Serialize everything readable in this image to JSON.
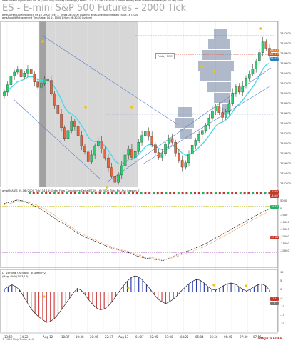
{
  "window": {
    "title": "ES - E-mini S&P 500 Futures - 2000 Tick",
    "info_lines": [
      "amaCurrentDayVWAP(ES 09-16 (2000 Tick) Nasdaq Exchange_Theme 1 0.5 1 2 3 Hi 08:30:00 Custom Hover) amaCurrentDayMedian(ES 09-16 (2000",
      "amaCurrentDayMedian(ES 09-16 (2000 Tick) ... Times 08:30:00 Custom) amaCurrentDayMedian(ES 09-16 (2000",
      "amaAutoFibRetracement Time/Label 14 14 1000 1 Hum 08:30:00 Custom)"
    ]
  },
  "price_pane": {
    "y_ticks": [
      "2852.00",
      "2850.00",
      "2848.00",
      "2846.00",
      "2844.00",
      "2842.00",
      "2840.00",
      "2838.00",
      "2836.00",
      "2834.00",
      "2832.00",
      "2830.00",
      "2828.00",
      "2826.00",
      "2824.00",
      "2822.00",
      "2820.00"
    ],
    "price_badges": [
      {
        "value": "2847.75",
        "color": "#e67e22"
      },
      {
        "value": "2847.50",
        "color": "#d35400"
      },
      {
        "value": "2845.75",
        "color": "#2980b9"
      }
    ],
    "prior_poc_label": "Friday POC"
  },
  "cumdelta_pane": {
    "label": "amaSMA(ES 09-16 (2000 Tick),14,14) Order Flow Cumulative Delta(ES 09-16 (2000 Tick),Bid Ask Session,0)",
    "y_ticks": [
      "5000",
      "0",
      "-5000",
      "-10000",
      "-15000",
      "-20000",
      "-25000",
      "-30000"
    ],
    "badges": [
      {
        "value": "-1542",
        "color": "#c0392b"
      },
      {
        "value": "-3442",
        "color": "#c0392b"
      },
      {
        "value": "29.53",
        "color": "#27ae60"
      },
      {
        "value": "-15 20",
        "color": "#c0392b"
      }
    ]
  },
  "oscillator_pane": {
    "label_lines": [
      "LT_Zeroing_Oscillator_3(Speed)V2",
      "(Mag) DIO*(14,3,14)"
    ],
    "y_ticks": [
      "10",
      "5",
      "0",
      "-5",
      "-10",
      "-15",
      "-20"
    ],
    "badges": [
      {
        "value": "1.1",
        "color": "#c0392b"
      },
      {
        "value": "0",
        "color": "#777777"
      }
    ]
  },
  "x_axis": {
    "ticks": [
      "13:59",
      "14:22",
      "Aug 12",
      "18:37",
      "19:38",
      "20:46",
      "22:57",
      "Aug 13",
      "01:07",
      "02:05",
      "03:00",
      "04:25",
      "05:04",
      "05:56",
      "06:45",
      "07:30",
      "07:56"
    ]
  },
  "footer": {
    "copyright": "© 2016 NinjaTrader, LLC",
    "logo_text": "NINJATRADER"
  },
  "colors": {
    "up_candle": "#2ecc71",
    "down_candle": "#e8643a",
    "session_shade": "#b7b7b7",
    "weekend_shade": "#8a8a8a",
    "vwap_line": "#4fd8e8",
    "channel_line": "#5b7fc7",
    "volume_profile": "#6e7f9c",
    "poc_line": "#e74c3c",
    "oscillator_up": "#2c3ea8",
    "oscillator_down": "#d04545",
    "signal_dot": "#f1c40f"
  },
  "chart_data": [
    {
      "type": "candlestick",
      "title": "ES - E-mini S&P 500 Futures - 2000 Tick",
      "ylim": [
        2819,
        2853
      ],
      "close": [
        2838.5,
        2840.0,
        2841.8,
        2842.6,
        2843.1,
        2841.6,
        2842.4,
        2843.3,
        2842.2,
        2840.6,
        2839.5,
        2840.3,
        2841.2,
        2840.9,
        2838.2,
        2835.8,
        2834.0,
        2831.2,
        2829.0,
        2830.6,
        2832.5,
        2831.4,
        2829.6,
        2827.4,
        2826.2,
        2824.2,
        2825.6,
        2827.5,
        2828.4,
        2826.8,
        2825.0,
        2823.0,
        2821.3,
        2820.0,
        2821.5,
        2823.4,
        2825.6,
        2826.8,
        2825.1,
        2826.3,
        2828.2,
        2829.6,
        2830.5,
        2829.4,
        2827.7,
        2826.1,
        2825.1,
        2825.9,
        2827.8,
        2829.0,
        2828.2,
        2826.0,
        2824.5,
        2823.1,
        2824.0,
        2825.8,
        2827.6,
        2828.6,
        2829.8,
        2830.6,
        2831.7,
        2833.2,
        2834.6,
        2835.6,
        2834.3,
        2833.3,
        2834.5,
        2836.2,
        2838.3,
        2839.6,
        2838.5,
        2839.8,
        2841.4,
        2842.2,
        2843.3,
        2844.9,
        2846.6,
        2848.8,
        2847.5,
        2846.0
      ]
    },
    {
      "type": "line",
      "title": "Order Flow Cumulative Delta",
      "ylim": [
        -32000,
        8000
      ],
      "series": [
        {
          "name": "Cumulative Delta",
          "values": [
            1500,
            2500,
            3400,
            2800,
            1000,
            -500,
            -2500,
            -5000,
            -7500,
            -9500,
            -12000,
            -14500,
            -16500,
            -18000,
            -19500,
            -21000,
            -22500,
            -23500,
            -24500,
            -25500,
            -27000,
            -28000,
            -28500,
            -29000,
            -29500,
            -28000,
            -26500,
            -25000,
            -24000,
            -22500,
            -21000,
            -19000,
            -17000,
            -15000,
            -13000,
            -11000,
            -9000,
            -7000,
            -5000,
            -3000,
            -1500
          ]
        },
        {
          "name": "SMA",
          "values": [
            800,
            1700,
            2600,
            2700,
            1800,
            500,
            -1200,
            -3500,
            -6000,
            -8500,
            -11000,
            -13500,
            -15500,
            -17200,
            -18800,
            -20300,
            -21800,
            -22900,
            -23900,
            -24900,
            -26200,
            -27300,
            -27900,
            -28400,
            -28900,
            -28500,
            -27300,
            -26000,
            -24900,
            -23600,
            -22200,
            -20400,
            -18400,
            -16400,
            -14400,
            -12400,
            -10400,
            -8400,
            -6400,
            -4400,
            -2700
          ]
        }
      ]
    },
    {
      "type": "bar",
      "title": "LT_Zeroing_Oscillator",
      "ylim": [
        -21,
        11
      ],
      "values": [
        1.5,
        3.0,
        4.0,
        3.0,
        1.0,
        -2.5,
        -6.0,
        -9.5,
        -12.0,
        -14.0,
        -15.5,
        -17.0,
        -16.5,
        -15.0,
        -12.5,
        -9.5,
        -6.5,
        -3.5,
        -0.5,
        2.0,
        1.0,
        -1.5,
        -4.5,
        -7.0,
        -9.0,
        -10.0,
        -9.5,
        -8.0,
        -5.5,
        -2.5,
        0.5,
        3.5,
        6.0,
        8.0,
        9.0,
        8.5,
        6.5,
        4.0,
        1.5,
        -1.5,
        -4.0,
        -5.5,
        -6.5,
        -5.5,
        -4.0,
        -2.0,
        0.5,
        2.5,
        4.5,
        6.0,
        7.0,
        6.5,
        5.0,
        3.0,
        1.5,
        1.0,
        2.0,
        3.5,
        4.5,
        5.0,
        4.5,
        3.0,
        1.5,
        0.5,
        1.5,
        3.0,
        4.0,
        4.5,
        3.5,
        1.1
      ]
    }
  ]
}
